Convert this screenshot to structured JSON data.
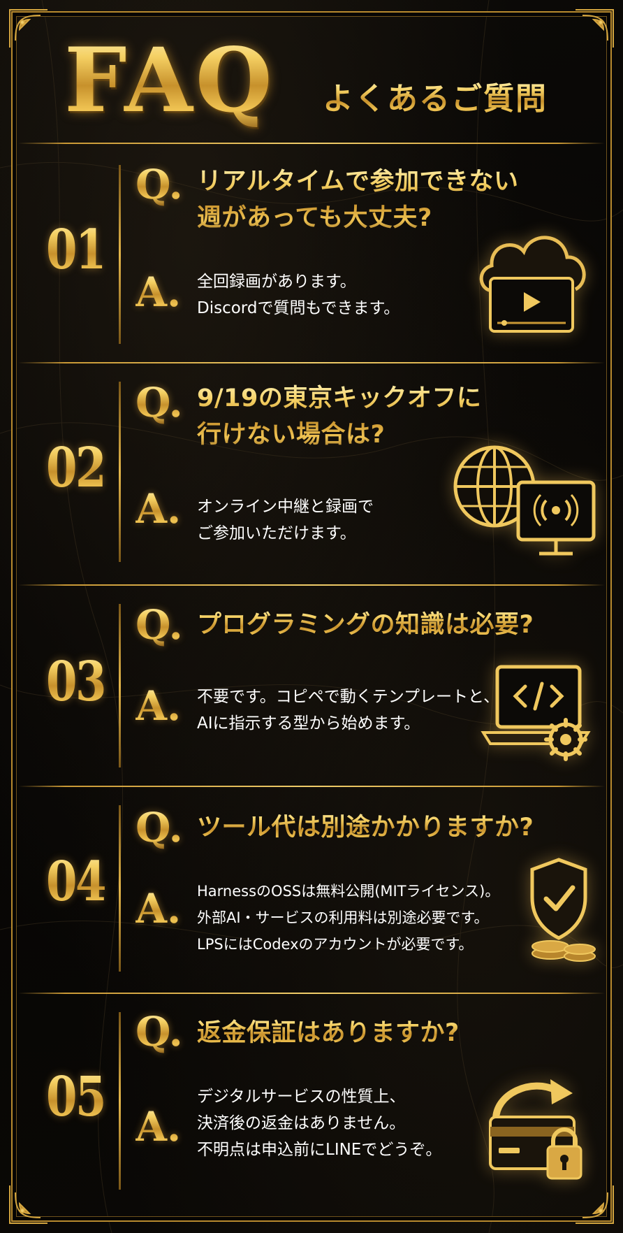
{
  "header": {
    "title": "FAQ",
    "subtitle": "よくあるご質問"
  },
  "labels": {
    "q": "Q.",
    "a": "A."
  },
  "faq": [
    {
      "number": "01",
      "question": [
        "リアルタイムで参加できない",
        "週があっても大丈夫?"
      ],
      "answer": [
        "全回録画があります。",
        "Discordで質問もできます。"
      ],
      "icon": "cloud-video-icon"
    },
    {
      "number": "02",
      "question": [
        "9/19の東京キックオフに",
        "行けない場合は?"
      ],
      "answer": [
        "オンライン中継と録画で",
        "ご参加いただけます。"
      ],
      "icon": "globe-monitor-icon"
    },
    {
      "number": "03",
      "question": [
        "プログラミングの知識は必要?"
      ],
      "answer": [
        "不要です。コピペで動くテンプレートと、",
        "AIに指示する型から始めます。"
      ],
      "icon": "laptop-code-gear-icon"
    },
    {
      "number": "04",
      "question": [
        "ツール代は別途かかりますか?"
      ],
      "answer": [
        "HarnessのOSSは無料公開(MITライセンス)。",
        "外部AI・サービスの利用料は別途必要です。",
        "LPSにはCodexのアカウントが必要です。"
      ],
      "icon": "shield-check-coins-icon"
    },
    {
      "number": "05",
      "question": [
        "返金保証はありますか?"
      ],
      "answer": [
        "デジタルサービスの性質上、",
        "決済後の返金はありません。",
        "不明点は申込前にLINEでどうぞ。"
      ],
      "icon": "card-lock-refresh-icon"
    }
  ]
}
